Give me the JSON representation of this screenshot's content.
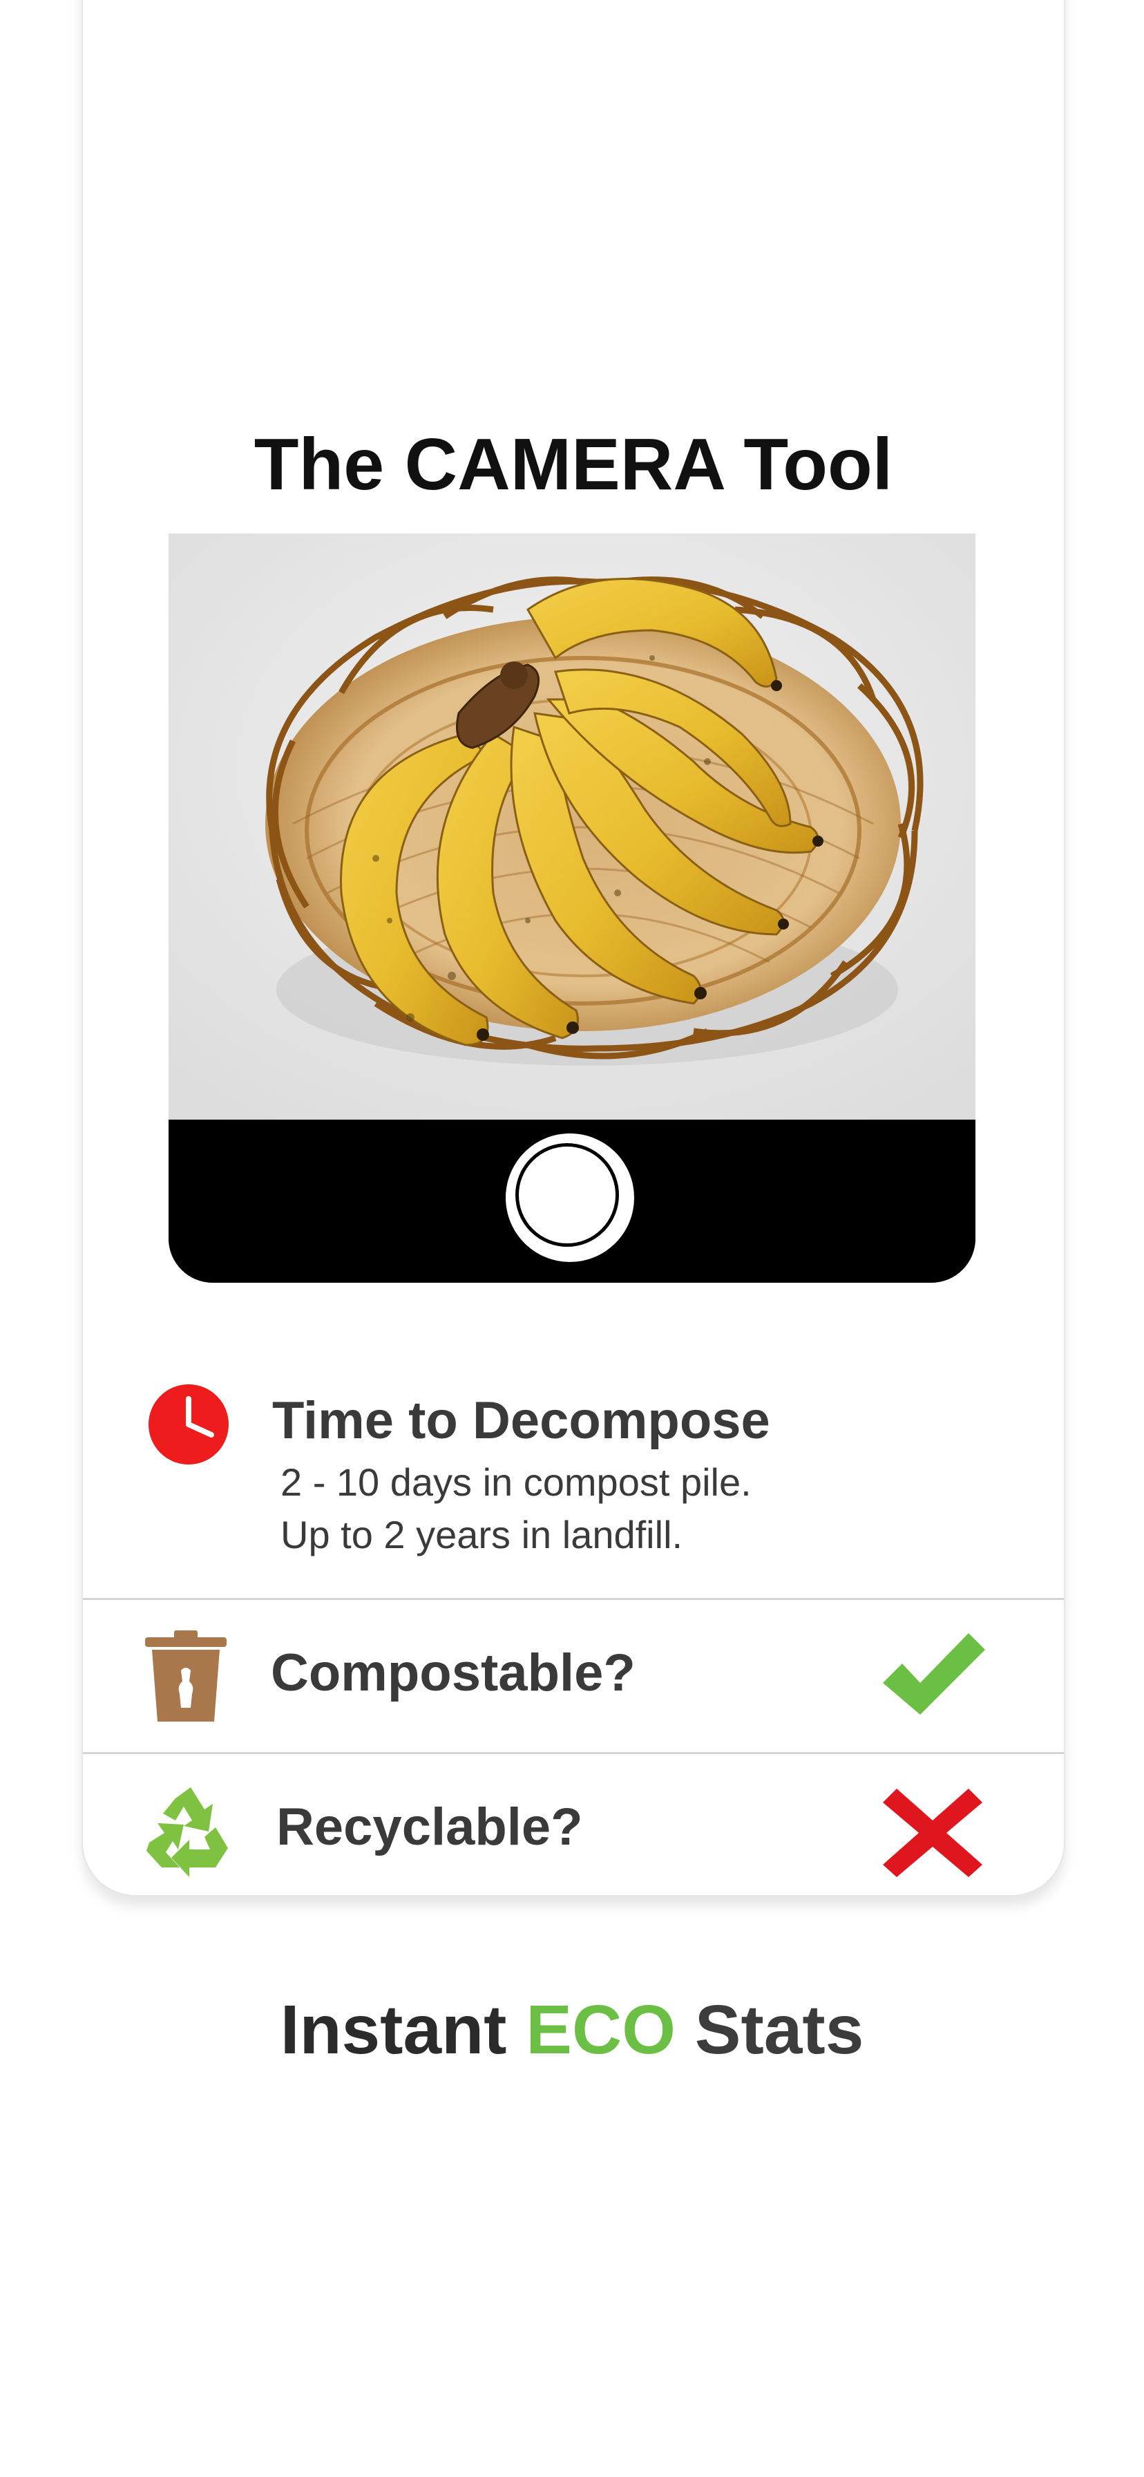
{
  "screen": {
    "title": "The CAMERA Tool",
    "camera": {
      "photo_subject": "bananas-in-wicker-basket",
      "shutter_label": "capture"
    },
    "decompose": {
      "icon": "clock-icon",
      "icon_color": "#ee1c1c",
      "heading": "Time to Decompose",
      "lines": [
        "2 - 10 days in compost pile.",
        "Up to 2 years in landfill."
      ]
    },
    "checks": [
      {
        "icon": "compost-bin-icon",
        "icon_color": "#a9774c",
        "label": "Compostable?",
        "status": "yes",
        "status_icon": "checkmark-icon",
        "status_color": "#6cbf45"
      },
      {
        "icon": "recycle-icon",
        "icon_color": "#7fc242",
        "label": "Recyclable?",
        "status": "no",
        "status_icon": "x-mark-icon",
        "status_color": "#e0161e"
      }
    ]
  },
  "tagline": {
    "part1": "Instant",
    "part2": "ECO",
    "part3": "Stats",
    "accent_color": "#6cbf45"
  }
}
